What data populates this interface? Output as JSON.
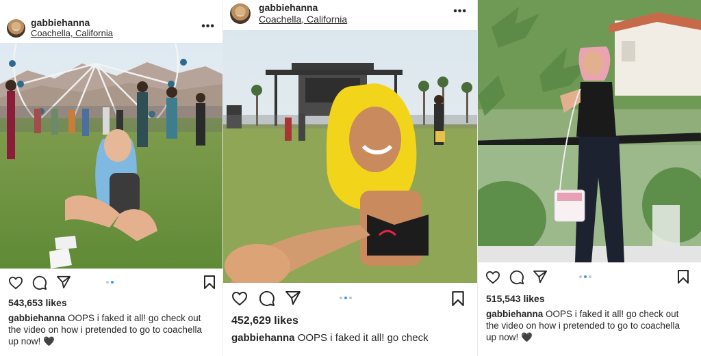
{
  "posts": [
    {
      "username": "gabbiehanna",
      "location": "Coachella, California",
      "more_glyph": "•••",
      "likes": "543,653 likes",
      "caption_user": "gabbiehanna",
      "caption_text": "OOPS i faked it all! go check out the video on how i pretended to go to coachella up now! 🖤",
      "carousel": {
        "count": 2,
        "active": 1
      }
    },
    {
      "username": "gabbiehanna",
      "location": "Coachella, California",
      "more_glyph": "•••",
      "likes": "452,629 likes",
      "caption_user": "gabbiehanna",
      "caption_text": "OOPS i faked it all! go check",
      "carousel": {
        "count": 3,
        "active": 2
      }
    },
    {
      "likes": "515,543 likes",
      "caption_user": "gabbiehanna",
      "caption_text": "OOPS i faked it all! go check out the video on how i pretended to go to coachella up now! 🖤",
      "carousel": {
        "count": 3,
        "active": 2
      }
    }
  ],
  "icons": [
    "heart-icon",
    "comment-icon",
    "share-icon",
    "bookmark-icon",
    "more-options-icon"
  ],
  "colors": {
    "text": "#262626",
    "carousel_active": "#3897f0",
    "carousel_inactive": "#c7c7c7"
  }
}
